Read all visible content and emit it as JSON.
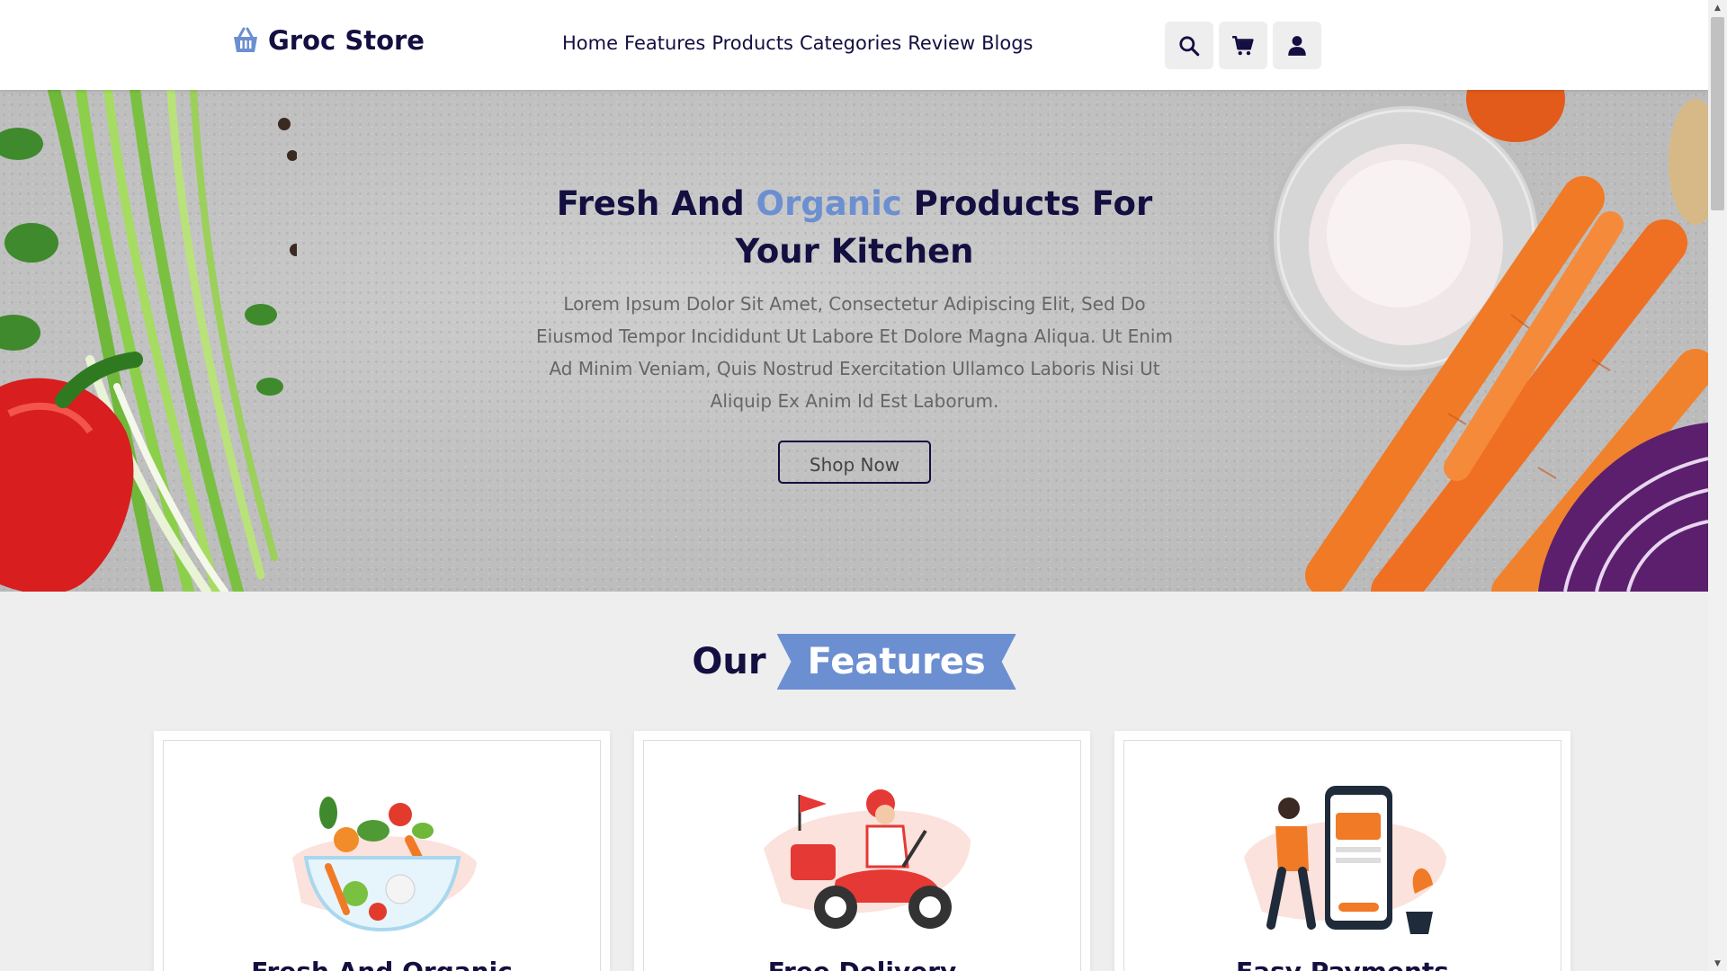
{
  "header": {
    "logo_text": "Groc Store",
    "logo_icon": "basket-icon",
    "nav": [
      "Home",
      "Features",
      "Products",
      "Categories",
      "Review",
      "Blogs"
    ],
    "icons": [
      "search-icon",
      "cart-icon",
      "user-icon"
    ]
  },
  "hero": {
    "title_part1": "Fresh And ",
    "title_accent": "Organic",
    "title_part2": " Products For Your Kitchen",
    "description": "Lorem Ipsum Dolor Sit Amet, Consectetur Adipiscing Elit, Sed Do Eiusmod Tempor Incididunt Ut Labore Et Dolore Magna Aliqua. Ut Enim Ad Minim Veniam, Quis Nostrud Exercitation Ullamco Laboris Nisi Ut Aliquip Ex Anim Id Est Laborum.",
    "button_label": "Shop Now"
  },
  "features": {
    "heading_plain": "Our",
    "heading_highlight": "Features",
    "cards": [
      {
        "title": "Fresh And Organic",
        "image": "salad-bowl-illustration"
      },
      {
        "title": "Free Delivery",
        "image": "scooter-delivery-illustration"
      },
      {
        "title": "Easy Payments",
        "image": "mobile-payment-illustration"
      }
    ]
  },
  "colors": {
    "primary": "#130f40",
    "accent": "#6c8fd1",
    "background": "#eeeeee"
  }
}
